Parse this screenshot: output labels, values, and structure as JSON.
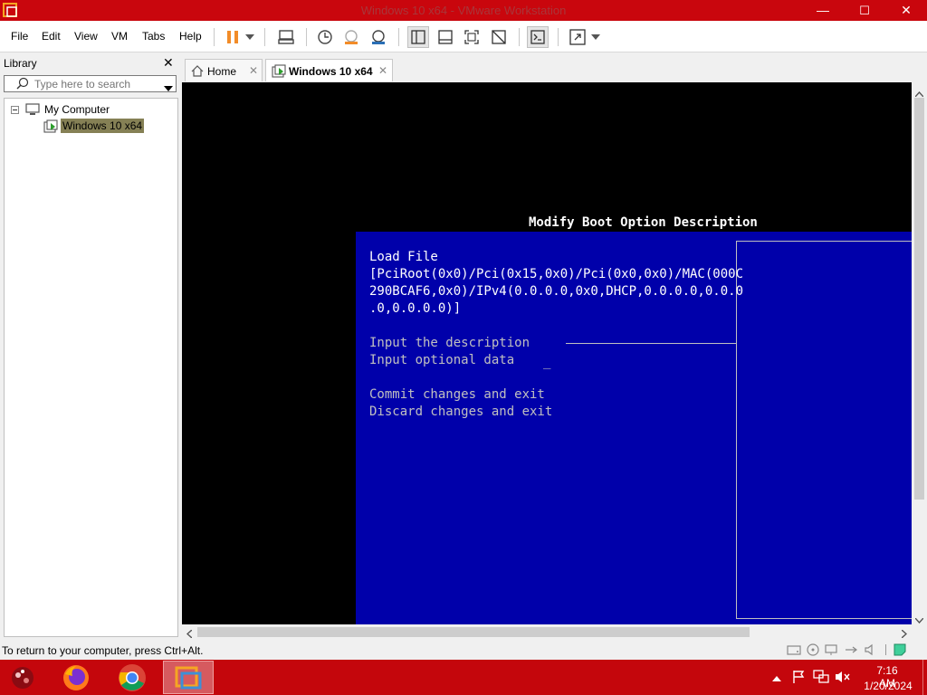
{
  "window": {
    "title": "Windows 10 x64 - VMware Workstation",
    "minimize": "—",
    "maximize": "☐",
    "close": "✕"
  },
  "menu": {
    "file": "File",
    "edit": "Edit",
    "view": "View",
    "vm": "VM",
    "tabs": "Tabs",
    "help": "Help"
  },
  "library": {
    "title": "Library",
    "close": "✕",
    "search_placeholder": "Type here to search",
    "tree": {
      "root": "My Computer",
      "child": "Windows 10 x64"
    }
  },
  "tabs": {
    "home": "Home",
    "vm": "Windows 10 x64",
    "close": "✕"
  },
  "bios": {
    "header": "Modify Boot Option Description",
    "title": "Load File",
    "path_lines": [
      "[PciRoot(0x0)/Pci(0x15,0x0)/Pci(0x0,0x0)/MAC(000C",
      "290BCAF6,0x0)/IPv4(0.0.0.0,0x0,DHCP,0.0.0.0,0.0.0",
      ".0,0.0.0.0)]"
    ],
    "input_description": "Input the description",
    "input_optional": "Input optional data",
    "cursor": "_",
    "commit": "Commit changes and exit",
    "discard": "Discard changes and exit"
  },
  "status": {
    "message": "To return to your computer, press Ctrl+Alt."
  },
  "taskbar": {
    "time": "7:16 AM",
    "date": "1/20/2024"
  },
  "colors": {
    "titlebar": "#c9060d",
    "bios_blue": "#0000aa",
    "taskbar": "#c4060c"
  }
}
